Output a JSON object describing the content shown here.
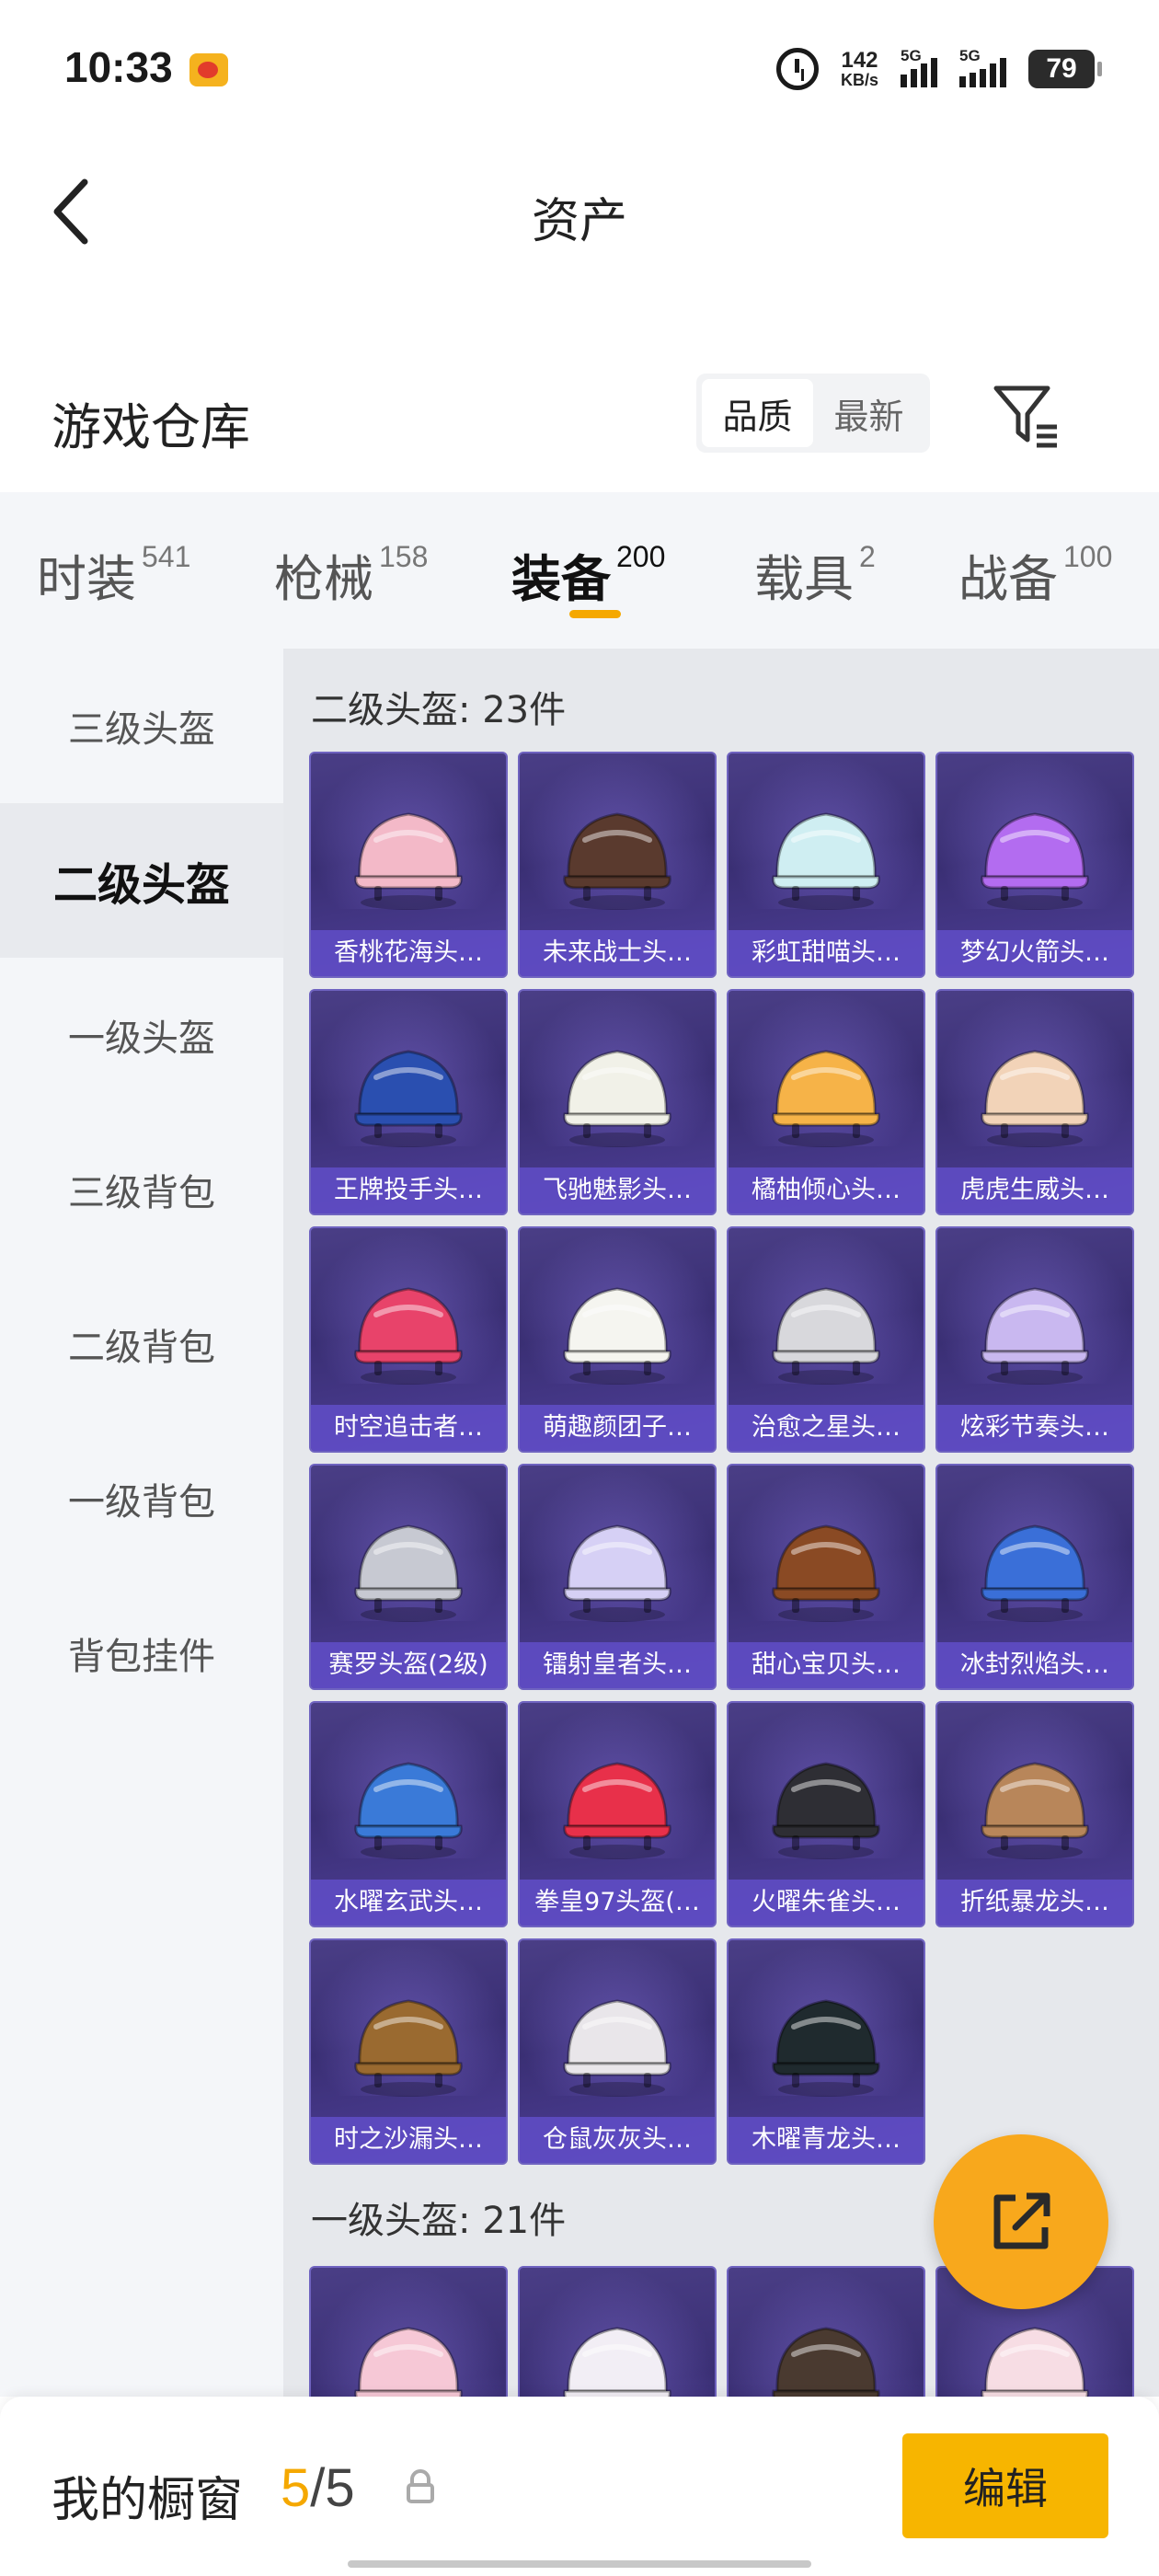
{
  "status_bar": {
    "time": "10:33",
    "net_speed_value": "142",
    "net_speed_unit": "KB/s",
    "sim1_label": "5G",
    "sim2_label": "5G",
    "battery": "79"
  },
  "header": {
    "title": "资产"
  },
  "warehouse": {
    "title": "游戏仓库",
    "sort_quality": "品质",
    "sort_newest": "最新"
  },
  "tabs": [
    {
      "label": "时装",
      "count": "541"
    },
    {
      "label": "枪械",
      "count": "158"
    },
    {
      "label": "装备",
      "count": "200"
    },
    {
      "label": "载具",
      "count": "2"
    },
    {
      "label": "战备",
      "count": "100"
    }
  ],
  "sidebar": [
    {
      "label": "三级头盔"
    },
    {
      "label": "二级头盔"
    },
    {
      "label": "一级头盔"
    },
    {
      "label": "三级背包"
    },
    {
      "label": "二级背包"
    },
    {
      "label": "一级背包"
    },
    {
      "label": "背包挂件"
    }
  ],
  "sections": [
    {
      "title": "二级头盔: 23件",
      "items": [
        {
          "name": "香桃花海头…",
          "color": "#f3b9c8"
        },
        {
          "name": "未来战士头…",
          "color": "#5a3a2e"
        },
        {
          "name": "彩虹甜喵头…",
          "color": "#cfeef2"
        },
        {
          "name": "梦幻火箭头…",
          "color": "#b36cf0"
        },
        {
          "name": "王牌投手头…",
          "color": "#2a4fb0"
        },
        {
          "name": "飞驰魅影头…",
          "color": "#f1f1e8"
        },
        {
          "name": "橘柚倾心头…",
          "color": "#f6b348"
        },
        {
          "name": "虎虎生威头…",
          "color": "#f2d3b8"
        },
        {
          "name": "时空追击者…",
          "color": "#e8436a"
        },
        {
          "name": "萌趣颜团子…",
          "color": "#f5f5f0"
        },
        {
          "name": "治愈之星头…",
          "color": "#d8d8dc"
        },
        {
          "name": "炫彩节奏头…",
          "color": "#c9b8f0"
        },
        {
          "name": "赛罗头盔(2级)",
          "color": "#c7c9d2"
        },
        {
          "name": "镭射皇者头…",
          "color": "#d6d0f5"
        },
        {
          "name": "甜心宝贝头…",
          "color": "#8a4a24"
        },
        {
          "name": "冰封烈焰头…",
          "color": "#3a6fd8"
        },
        {
          "name": "水曜玄武头…",
          "color": "#3a7ad8"
        },
        {
          "name": "拳皇97头盔(…",
          "color": "#e8304a"
        },
        {
          "name": "火曜朱雀头…",
          "color": "#2e2e34"
        },
        {
          "name": "折纸暴龙头…",
          "color": "#b8865a"
        },
        {
          "name": "时之沙漏头…",
          "color": "#9a6a30"
        },
        {
          "name": "仓鼠灰灰头…",
          "color": "#e9e6ea"
        },
        {
          "name": "木曜青龙头…",
          "color": "#1f2a2e"
        }
      ]
    },
    {
      "title": "一级头盔: 21件",
      "items": [
        {
          "name": "",
          "color": "#f6c8d6"
        },
        {
          "name": "",
          "color": "#f2eef5"
        },
        {
          "name": "",
          "color": "#4a3a30"
        },
        {
          "name": "",
          "color": "#f7dde4"
        }
      ]
    }
  ],
  "showcase": {
    "label": "我的橱窗",
    "current": "5",
    "separator": "/",
    "total": "5",
    "edit_label": "编辑"
  },
  "colors": {
    "accent": "#f5a800",
    "card_bg": "#3a2f74",
    "card_label_bg": "#604ec8"
  }
}
